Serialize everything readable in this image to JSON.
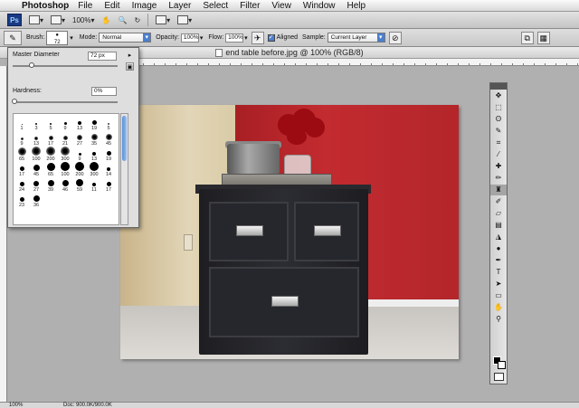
{
  "menubar": {
    "app_name": "Photoshop",
    "items": [
      "File",
      "Edit",
      "Image",
      "Layer",
      "Select",
      "Filter",
      "View",
      "Window",
      "Help"
    ]
  },
  "appbar": {
    "logo": "Ps",
    "zoom": "100%"
  },
  "options": {
    "brush_label": "Brush:",
    "brush_size": "72",
    "mode_label": "Mode:",
    "mode_value": "Normal",
    "opacity_label": "Opacity:",
    "opacity_value": "100%",
    "flow_label": "Flow:",
    "flow_value": "100%",
    "aligned_label": "Aligned",
    "sample_label": "Sample:",
    "sample_value": "Current Layer"
  },
  "document": {
    "title": "end table before.jpg @ 100% (RGB/8)"
  },
  "brush_panel": {
    "master_diameter_label": "Master Diameter",
    "master_diameter_value": "72 px",
    "hardness_label": "Hardness:",
    "hardness_value": "0%",
    "master_diameter_fraction": 0.18,
    "hardness_fraction": 0.0,
    "presets": [
      "1",
      "3",
      "5",
      "9",
      "13",
      "19",
      "5",
      "9",
      "13",
      "17",
      "21",
      "27",
      "35",
      "45",
      "65",
      "100",
      "200",
      "300",
      "9",
      "13",
      "19",
      "17",
      "45",
      "65",
      "100",
      "200",
      "300",
      "14",
      "24",
      "27",
      "39",
      "46",
      "59",
      "11",
      "17",
      "23",
      "36"
    ]
  },
  "tools": [
    "move",
    "marquee",
    "lasso",
    "quick-select",
    "crop",
    "eyedropper",
    "heal",
    "brush",
    "clone-stamp",
    "history-brush",
    "eraser",
    "gradient",
    "blur",
    "dodge",
    "pen",
    "type",
    "path-select",
    "shape",
    "hand",
    "zoom"
  ],
  "statusbar": {
    "zoom": "100%",
    "doc_size": "Doc: 900.0K/900.0K"
  }
}
